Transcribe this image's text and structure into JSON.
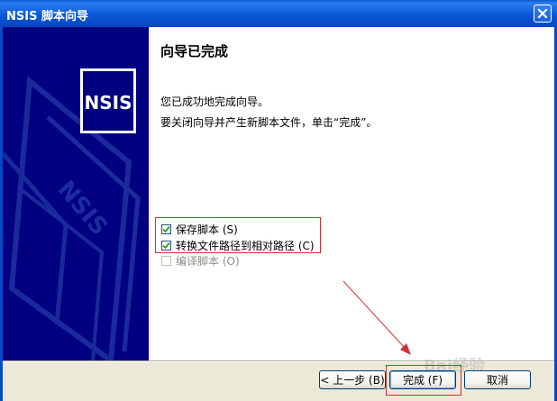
{
  "window": {
    "title": "NSIS 脚本向导"
  },
  "sidebar": {
    "logo_text": "NSIS"
  },
  "content": {
    "heading": "向导已完成",
    "paragraph1": "您已成功地完成向导。",
    "paragraph2": "要关闭向导并产生新脚本文件，单击“完成”。"
  },
  "options": [
    {
      "label": "保存脚本 (S)",
      "checked": true,
      "enabled": true
    },
    {
      "label": "转换文件路径到相对路径 (C)",
      "checked": true,
      "enabled": true
    },
    {
      "label": "编译脚本 (O)",
      "checked": false,
      "enabled": false
    }
  ],
  "buttons": {
    "back": "< 上一步 (B)",
    "finish": "完成 (F)",
    "cancel": "取消"
  },
  "annotation_color": "#d03030"
}
